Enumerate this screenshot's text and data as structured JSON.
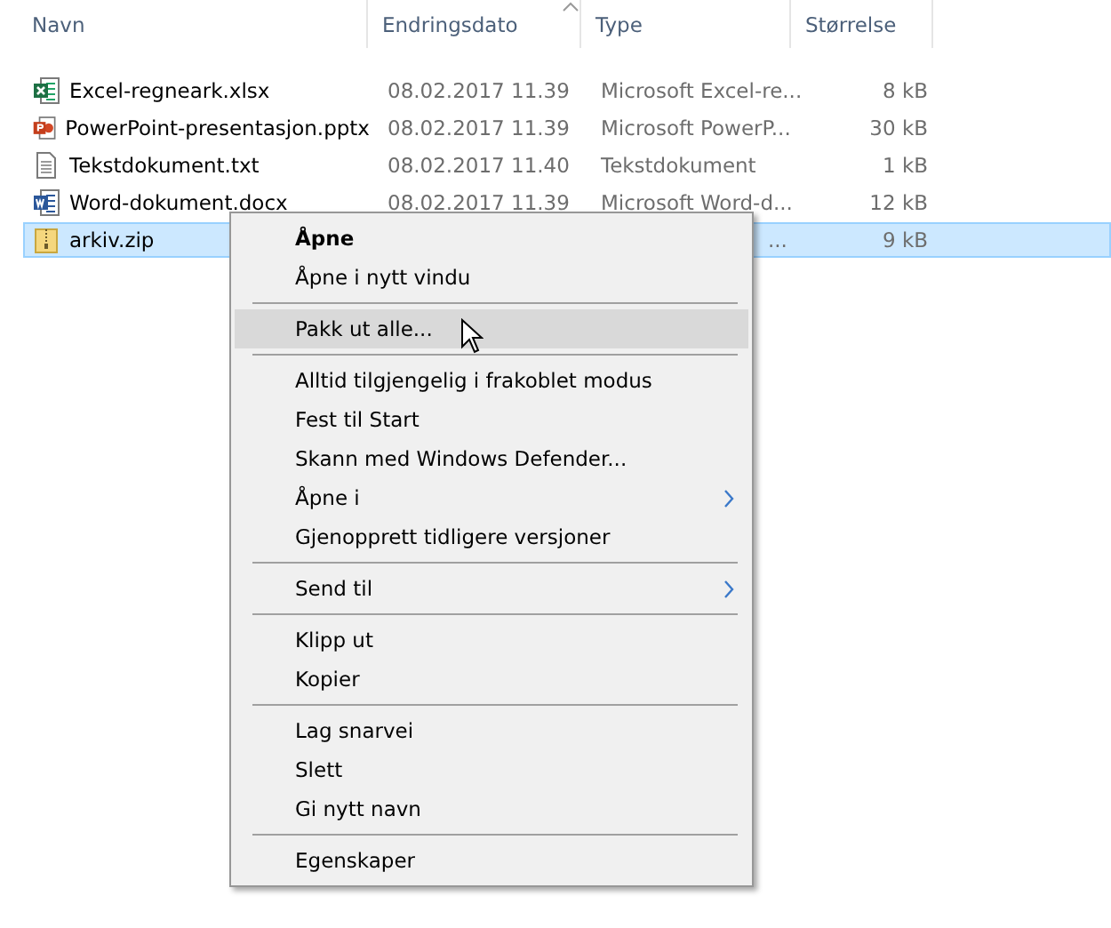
{
  "columns": [
    "Navn",
    "Endringsdato",
    "Type",
    "Størrelse"
  ],
  "files": [
    {
      "name": "Excel-regneark.xlsx",
      "kind": "excel",
      "date": "08.02.2017 11.39",
      "type": "Microsoft Excel-re...",
      "size": "8 kB",
      "selected": false
    },
    {
      "name": "PowerPoint-presentasjon.pptx",
      "kind": "powerpoint",
      "date": "08.02.2017 11.39",
      "type": "Microsoft PowerP...",
      "size": "30 kB",
      "selected": false
    },
    {
      "name": "Tekstdokument.txt",
      "kind": "text",
      "date": "08.02.2017 11.40",
      "type": "Tekstdokument",
      "size": "1 kB",
      "selected": false
    },
    {
      "name": "Word-dokument.docx",
      "kind": "word",
      "date": "08.02.2017 11.39",
      "type": "Microsoft Word-d...",
      "size": "12 kB",
      "selected": false
    },
    {
      "name": "arkiv.zip",
      "kind": "zip",
      "type": "...",
      "size": "9 kB",
      "selected": true
    }
  ],
  "context_menu": [
    {
      "kind": "item",
      "label": "Åpne",
      "bold": true
    },
    {
      "kind": "item",
      "label": "Åpne i nytt vindu"
    },
    {
      "kind": "separator"
    },
    {
      "kind": "item",
      "label": "Pakk ut alle...",
      "hovered": true
    },
    {
      "kind": "separator"
    },
    {
      "kind": "item",
      "label": "Alltid tilgjengelig i frakoblet modus"
    },
    {
      "kind": "item",
      "label": "Fest til Start"
    },
    {
      "kind": "item",
      "label": "Skann med Windows Defender..."
    },
    {
      "kind": "item",
      "label": "Åpne i",
      "submenu": true
    },
    {
      "kind": "item",
      "label": "Gjenopprett tidligere versjoner"
    },
    {
      "kind": "separator"
    },
    {
      "kind": "item",
      "label": "Send til",
      "submenu": true
    },
    {
      "kind": "separator"
    },
    {
      "kind": "item",
      "label": "Klipp ut"
    },
    {
      "kind": "item",
      "label": "Kopier"
    },
    {
      "kind": "separator"
    },
    {
      "kind": "item",
      "label": "Lag snarvei"
    },
    {
      "kind": "item",
      "label": "Slett"
    },
    {
      "kind": "item",
      "label": "Gi nytt navn"
    },
    {
      "kind": "separator"
    },
    {
      "kind": "item",
      "label": "Egenskaper"
    }
  ]
}
